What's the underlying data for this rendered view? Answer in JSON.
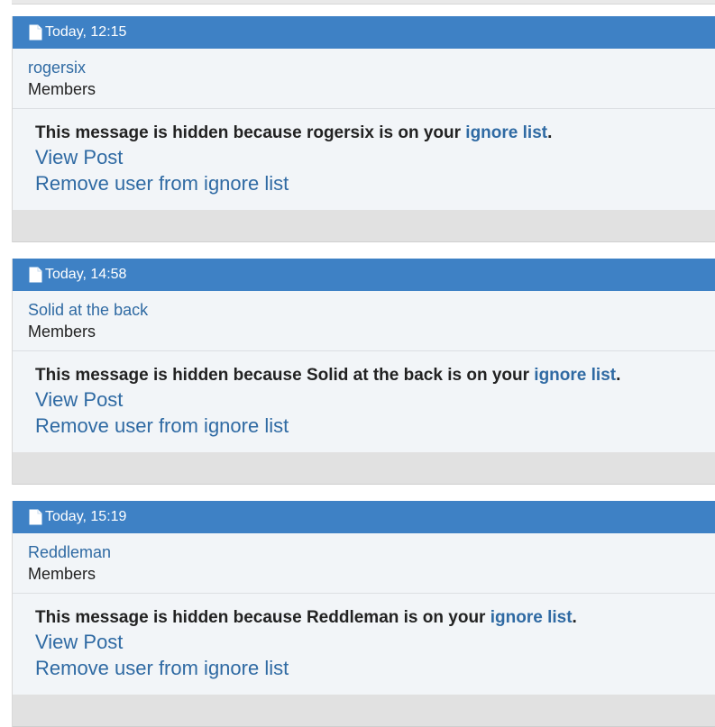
{
  "posts": [
    {
      "time": "Today, 12:15",
      "username": "rogersix",
      "usertitle": "Members",
      "msg_prefix": "This message is hidden because ",
      "msg_name": "rogersix",
      "msg_mid": " is on your ",
      "ignore_link": "ignore list",
      "msg_end": ".",
      "view_post": "View Post",
      "remove_user": "Remove user from ignore list"
    },
    {
      "time": "Today, 14:58",
      "username": "Solid at the back",
      "usertitle": "Members",
      "msg_prefix": "This message is hidden because ",
      "msg_name": "Solid at the back",
      "msg_mid": " is on your ",
      "ignore_link": "ignore list",
      "msg_end": ".",
      "view_post": "View Post",
      "remove_user": "Remove user from ignore list"
    },
    {
      "time": "Today, 15:19",
      "username": "Reddleman",
      "usertitle": "Members",
      "msg_prefix": "This message is hidden because ",
      "msg_name": "Reddleman",
      "msg_mid": " is on your ",
      "ignore_link": "ignore list",
      "msg_end": ".",
      "view_post": "View Post",
      "remove_user": "Remove user from ignore list"
    }
  ],
  "icons": {
    "post_icon": "document-icon"
  },
  "colors": {
    "header_blue": "#3e81c5",
    "link_blue": "#2f6aa3",
    "post_bg": "#f2f5f8",
    "footer_gray": "#e1e1e1"
  }
}
